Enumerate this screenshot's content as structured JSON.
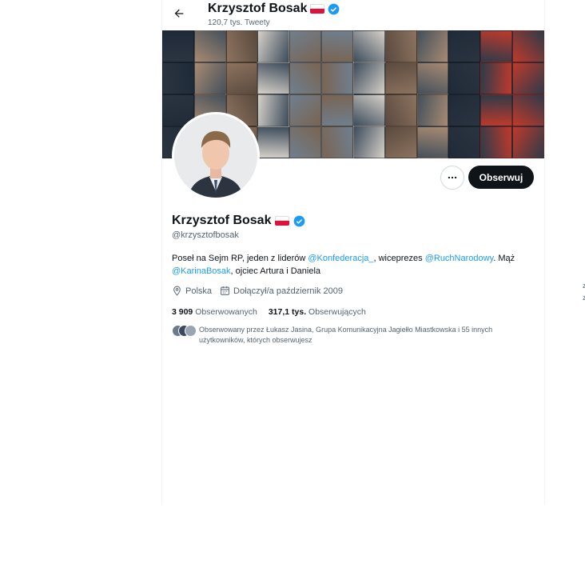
{
  "header": {
    "title": "Krzysztof Bosak",
    "tweet_count": "120,7 tys. Tweety"
  },
  "profile": {
    "name": "Krzysztof Bosak",
    "handle": "@krzysztofbosak",
    "bio": {
      "part1": "Poseł na Sejm RP, jeden z liderów ",
      "mention1": "@Konfederacja_",
      "part2": ", wiceprezes ",
      "mention2": "@RuchNarodowy",
      "part3": ". Mąż ",
      "mention3": "@KarinaBosak",
      "part4": ", ojciec Artura i Daniela"
    },
    "location": "Polska",
    "joined": "Dołączył/a październik 2009",
    "following_count": "3 909",
    "following_label": "Obserwowanych",
    "followers_count": "317,1 tys.",
    "followers_label": "Obserwujących",
    "followed_by": "Obserwowany przez Łukasz Jasina, Grupa Komunikacyjna Jagiełło Miastkowska i 55 innych użytkowników, których obserwujesz"
  },
  "actions": {
    "follow_label": "Obserwuj",
    "more_icon": "more-icon"
  },
  "colors": {
    "accent": "#1d9bf0",
    "follow_bg": "#0f1419",
    "muted": "#536471"
  },
  "edge_text": [
    "z",
    "z"
  ]
}
